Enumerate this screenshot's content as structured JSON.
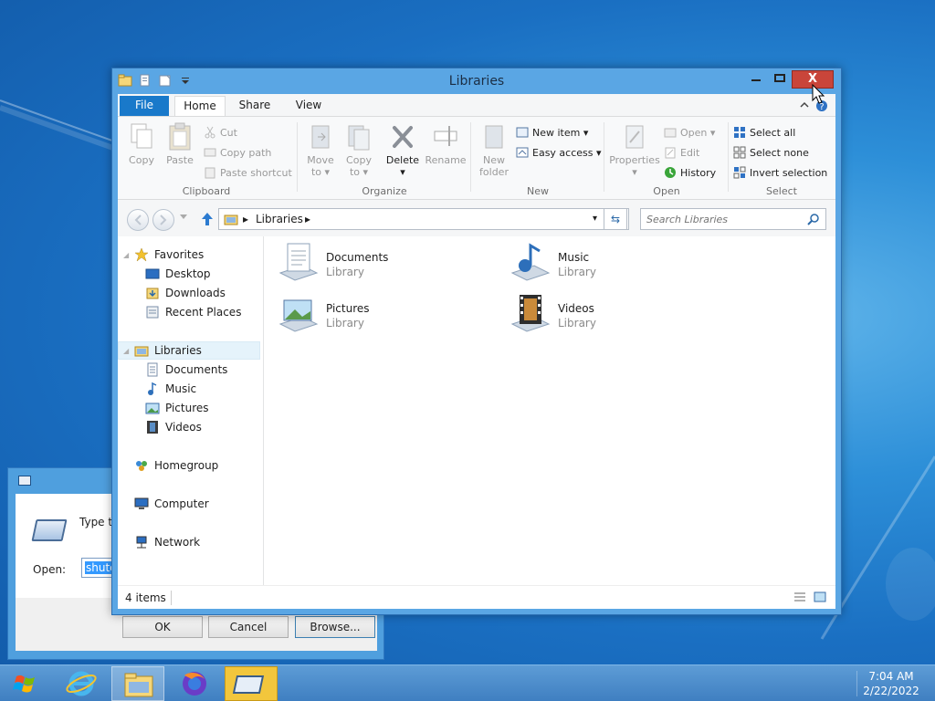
{
  "colors": {
    "desktop": "#1a6fc2",
    "titlebar": "#5aa6e4",
    "close_button": "#c9453a",
    "file_tab": "#1979ca",
    "selection": "#3399ff",
    "taskbar_highlight": "#f2c63c"
  },
  "run_dialog": {
    "description": "Type the name of a program, folder, document, or Internet resource",
    "open_label": "Open:",
    "open_value": "shutdown",
    "buttons": {
      "ok": "OK",
      "cancel": "Cancel",
      "browse": "Browse..."
    }
  },
  "window": {
    "title": "Libraries",
    "controls": {
      "minimize": "▬",
      "maximize": "□",
      "close": "X"
    }
  },
  "ribbon": {
    "tabs": {
      "file": "File",
      "home": "Home",
      "share": "Share",
      "view": "View"
    },
    "minimize_icon": "chevron-up-icon",
    "help_icon": "help-icon",
    "groups": {
      "clipboard": {
        "label": "Clipboard",
        "copy": "Copy",
        "paste": "Paste",
        "cut": "Cut",
        "copy_path": "Copy path",
        "paste_shortcut": "Paste shortcut"
      },
      "organize": {
        "label": "Organize",
        "move_to_1": "Move",
        "move_to_2": "to ▾",
        "copy_to_1": "Copy",
        "copy_to_2": "to ▾",
        "delete": "Delete",
        "delete_arrow": "▾",
        "rename": "Rename"
      },
      "new": {
        "label": "New",
        "new_folder_1": "New",
        "new_folder_2": "folder",
        "new_item": "New item ▾",
        "easy_access": "Easy access ▾"
      },
      "open": {
        "label": "Open",
        "properties": "Properties",
        "properties_arrow": "▾",
        "open": "Open ▾",
        "edit": "Edit",
        "history": "History"
      },
      "select": {
        "label": "Select",
        "select_all": "Select all",
        "select_none": "Select none",
        "invert_selection": "Invert selection"
      }
    }
  },
  "address_bar": {
    "crumb_arrow": "▸",
    "crumb": "Libraries",
    "crumb_arrow_after": "▸",
    "dropdown": "▾",
    "refresh_icon": "⇆",
    "search_placeholder": "Search Libraries"
  },
  "nav_pane": {
    "favorites": "Favorites",
    "desktop": "Desktop",
    "downloads": "Downloads",
    "recent_places": "Recent Places",
    "libraries": "Libraries",
    "documents": "Documents",
    "music": "Music",
    "pictures": "Pictures",
    "videos": "Videos",
    "homegroup": "Homegroup",
    "computer": "Computer",
    "network": "Network"
  },
  "libraries": [
    {
      "name": "Documents",
      "type": "Library"
    },
    {
      "name": "Music",
      "type": "Library"
    },
    {
      "name": "Pictures",
      "type": "Library"
    },
    {
      "name": "Videos",
      "type": "Library"
    }
  ],
  "status": {
    "item_count": "4 items"
  },
  "taskbar": {
    "time": "7:04 AM",
    "date": "2/22/2022"
  }
}
